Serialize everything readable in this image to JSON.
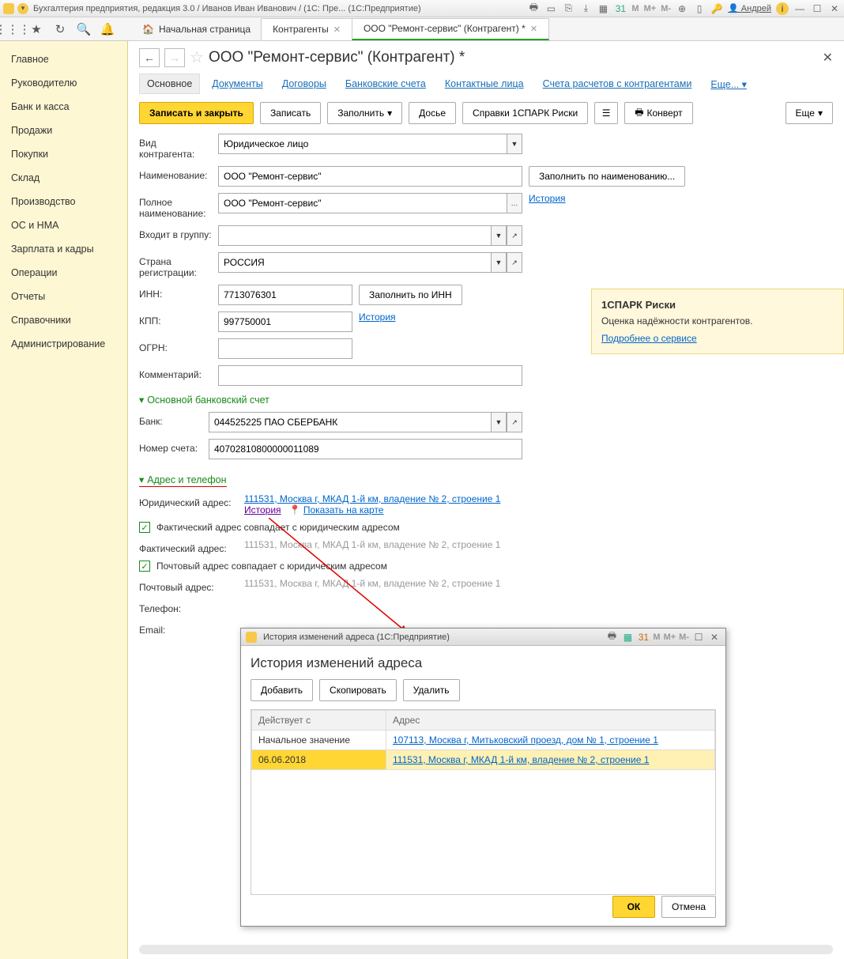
{
  "titlebar": {
    "text": "Бухгалтерия предприятия, редакция 3.0 / Иванов Иван Иванович / (1С: Пре...  (1С:Предприятие)",
    "user": "Андрей"
  },
  "tabs": {
    "home": "Начальная страница",
    "t1": "Контрагенты",
    "t2": "ООО \"Ремонт-сервис\" (Контрагент) *"
  },
  "sidebar": {
    "items": [
      "Главное",
      "Руководителю",
      "Банк и касса",
      "Продажи",
      "Покупки",
      "Склад",
      "Производство",
      "ОС и НМА",
      "Зарплата и кадры",
      "Операции",
      "Отчеты",
      "Справочники",
      "Администрирование"
    ]
  },
  "page": {
    "title": "ООО \"Ремонт-сервис\" (Контрагент) *",
    "subtabs": [
      "Основное",
      "Документы",
      "Договоры",
      "Банковские счета",
      "Контактные лица",
      "Счета расчетов с контрагентами",
      "Еще..."
    ],
    "buttons": {
      "save_close": "Записать и закрыть",
      "save": "Записать",
      "fill": "Заполнить",
      "dossier": "Досье",
      "spark": "Справки 1СПАРК Риски",
      "envelope": "Конверт",
      "more": "Еще"
    }
  },
  "form": {
    "kind_label": "Вид контрагента:",
    "kind_value": "Юридическое лицо",
    "name_label": "Наименование:",
    "name_value": "ООО \"Ремонт-сервис\"",
    "fill_by_name": "Заполнить по наименованию...",
    "fullname_label": "Полное наименование:",
    "fullname_value": "ООО \"Ремонт-сервис\"",
    "history": "История",
    "group_label": "Входит в группу:",
    "country_label": "Страна регистрации:",
    "country_value": "РОССИЯ",
    "inn_label": "ИНН:",
    "inn_value": "7713076301",
    "fill_by_inn": "Заполнить по ИНН",
    "kpp_label": "КПП:",
    "kpp_value": "997750001",
    "ogrn_label": "ОГРН:",
    "comment_label": "Комментарий:",
    "bank_section": "Основной банковский счет",
    "bank_label": "Банк:",
    "bank_value": "044525225 ПАО СБЕРБАНК",
    "account_label": "Номер счета:",
    "account_value": "40702810800000011089",
    "addr_section": "Адрес и телефон",
    "legal_addr_label": "Юридический адрес:",
    "legal_addr_value": "111531, Москва г, МКАД 1-й км, владение № 2, строение 1",
    "show_map": "Показать на карте",
    "fact_same": "Фактический адрес совпадает с юридическим адресом",
    "fact_label": "Фактический адрес:",
    "fact_value": "111531, Москва г, МКАД 1-й км, владение № 2, строение 1",
    "post_same": "Почтовый адрес совпадает с юридическим адресом",
    "post_label": "Почтовый адрес:",
    "post_value": "111531, Москва г, МКАД 1-й км, владение № 2, строение 1",
    "phone_label": "Телефон:",
    "email_label": "Email:"
  },
  "info": {
    "title": "1СПАРК Риски",
    "text": "Оценка надёжности контрагентов.",
    "more": "Подробнее о сервисе"
  },
  "dialog": {
    "winTitle": "История изменений адреса  (1С:Предприятие)",
    "title": "История изменений адреса",
    "add": "Добавить",
    "copy": "Скопировать",
    "delete": "Удалить",
    "col1": "Действует с",
    "col2": "Адрес",
    "r1c1": "Начальное значение",
    "r1c2": "107113, Москва г, Митьковский проезд, дом № 1, строение 1",
    "r2c1": "06.06.2018",
    "r2c2": "111531, Москва г, МКАД 1-й км, владение № 2, строение 1",
    "ok": "ОК",
    "cancel": "Отмена"
  }
}
